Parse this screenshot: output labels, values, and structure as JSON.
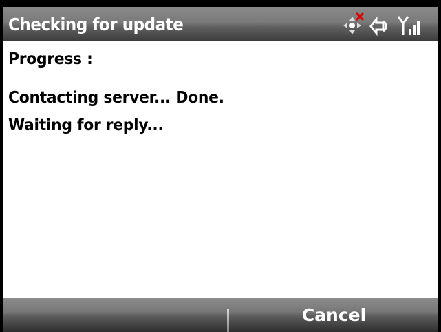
{
  "title_bar": {
    "title": "Checking for update",
    "status_icons": [
      "navigation-pad-icon",
      "no-connection-x-icon",
      "data-connection-icon",
      "signal-strength-icon"
    ]
  },
  "content": {
    "heading": "Progress :",
    "lines": [
      "Contacting server... Done.",
      "Waiting for reply..."
    ]
  },
  "softkeys": {
    "left_label": "",
    "right_label": "Cancel"
  },
  "colors": {
    "title_bar": "#7a7a7a",
    "background": "#ffffff",
    "text": "#000000",
    "error_x": "#e00000"
  }
}
